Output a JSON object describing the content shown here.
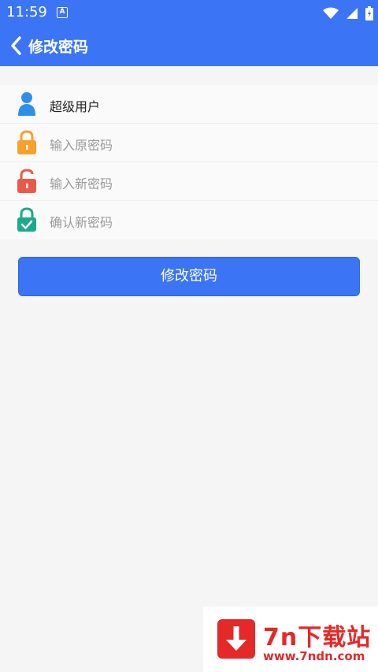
{
  "status_bar": {
    "time": "11:59",
    "notification_label": "A"
  },
  "header": {
    "title": "修改密码"
  },
  "form": {
    "username": "超级用户",
    "old_password_placeholder": "输入原密码",
    "new_password_placeholder": "输入新密码",
    "confirm_password_placeholder": "确认新密码"
  },
  "actions": {
    "submit_label": "修改密码"
  },
  "watermark": {
    "name": "7n下载站",
    "url": "www.7ndn.com"
  },
  "icons": {
    "user": "user-icon",
    "old_lock": "lock-closed-icon",
    "new_lock": "lock-open-icon",
    "confirm_lock": "lock-check-icon"
  },
  "colors": {
    "primary": "#3b74f5",
    "user_icon": "#2f8fe8",
    "old_lock": "#f5a12a",
    "new_lock": "#ea5a4a",
    "confirm_lock": "#1ea98a"
  }
}
